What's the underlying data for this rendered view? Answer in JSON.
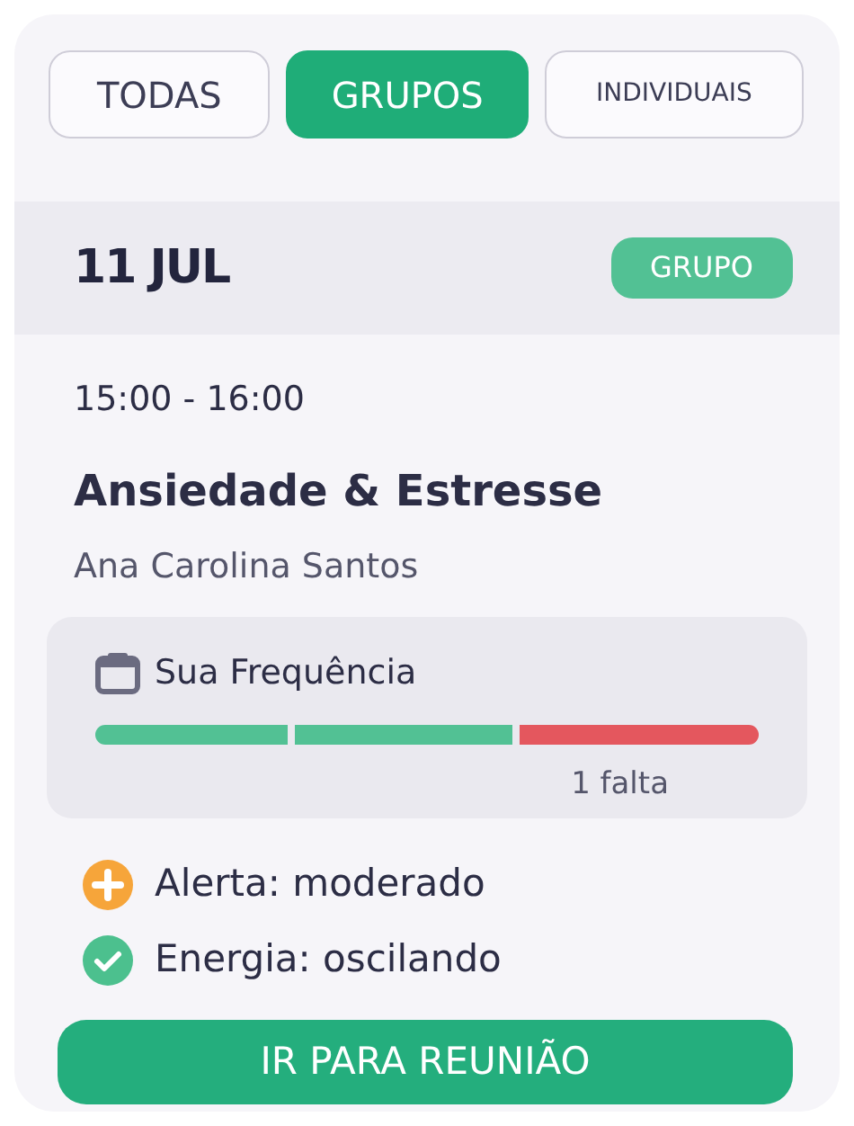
{
  "tabs": [
    {
      "label": "TODAS",
      "selected": false
    },
    {
      "label": "GRUPOS",
      "selected": true
    },
    {
      "label": "INDIVIDUAIS",
      "selected": false
    }
  ],
  "session": {
    "date": "11 JUL",
    "badge": "GRUPO",
    "time": "15:00 - 16:00",
    "title": "Ansiedade & Estresse",
    "therapist": "Ana Carolina Santos"
  },
  "attendance": {
    "title": "Sua Frequência",
    "segments": [
      {
        "color": "#52c194"
      },
      {
        "color": "#52c194"
      },
      {
        "color": "#e4575e"
      }
    ],
    "note": "1 falta"
  },
  "statuses": [
    {
      "kind": "alert",
      "text": "Alerta: moderado"
    },
    {
      "kind": "ok",
      "text": "Energia: oscilando"
    }
  ],
  "button": "IR PARA REUNIÃO"
}
